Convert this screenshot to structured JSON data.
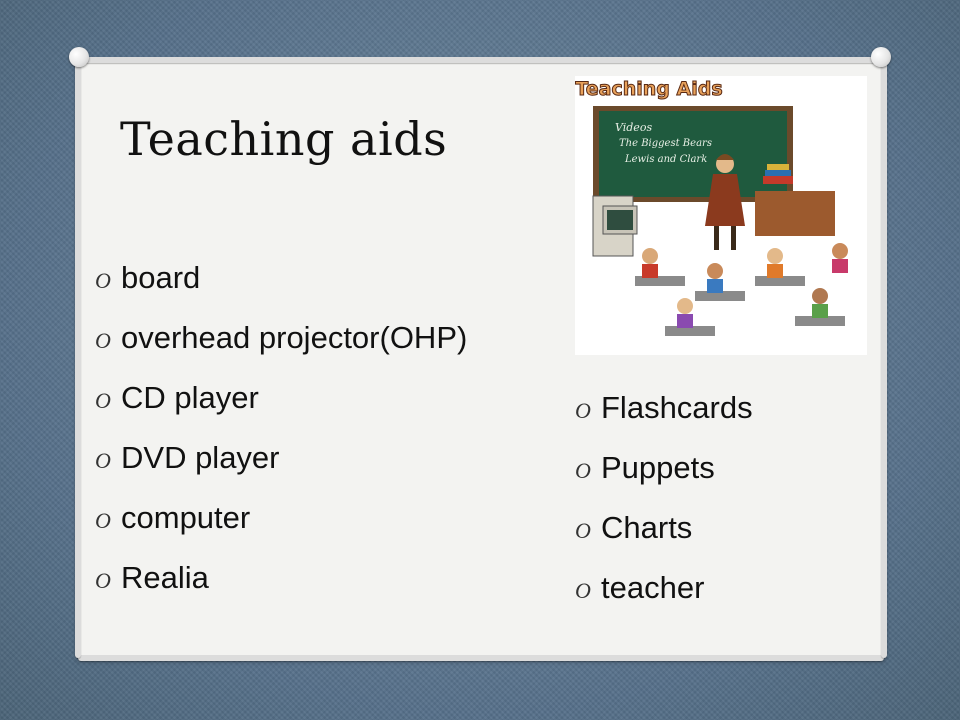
{
  "slide": {
    "title": "Teaching aids",
    "bullet_glyph": "O",
    "left_items": [
      "board",
      "overhead projector(OHP)",
      "CD player",
      "DVD player",
      "computer",
      "Realia"
    ],
    "right_items": [
      "Flashcards",
      "Puppets",
      "Charts",
      "teacher"
    ],
    "illustration": {
      "banner": "Teaching Aids",
      "board_lines": [
        "Videos",
        "The Biggest Bears",
        "Lewis and Clark"
      ]
    }
  },
  "colors": {
    "background": "#5f7a8f",
    "card": "#f3f3f1",
    "text": "#111111",
    "chalkboard": "#1f5a3e",
    "banner": "#e8a15a"
  }
}
